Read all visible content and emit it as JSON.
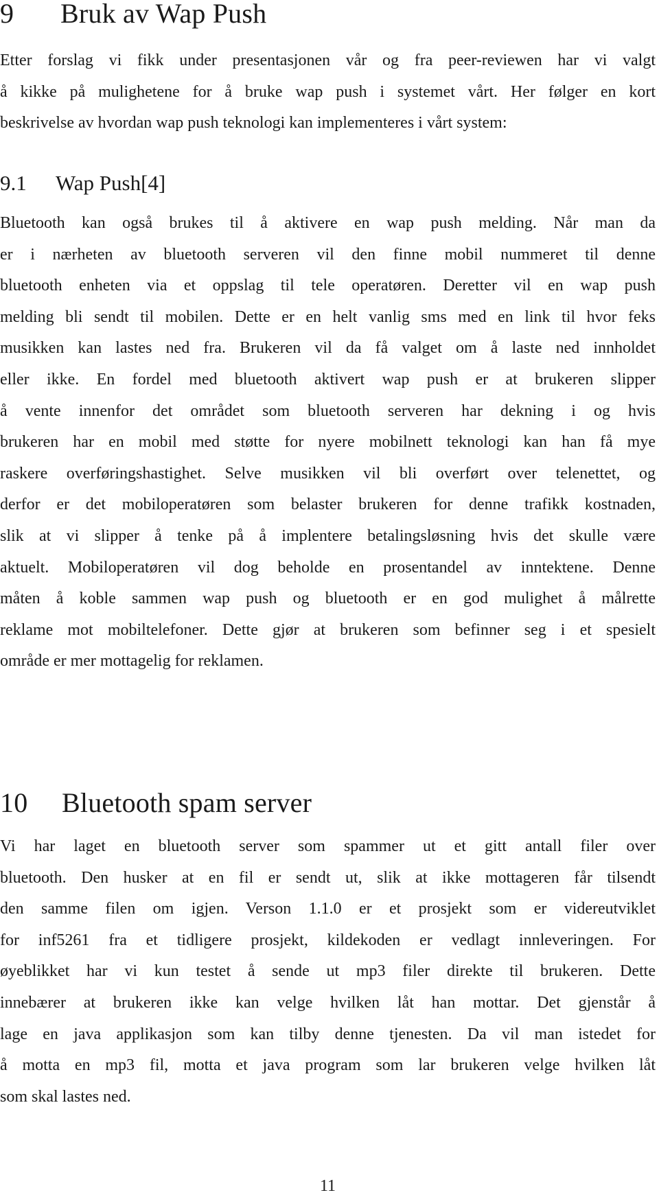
{
  "section_9": {
    "number": "9",
    "title": "Bruk av Wap Push",
    "intro_lines": [
      "Etter forslag vi fikk under presentasjonen vår og fra peer-reviewen har vi valgt",
      "å kikke på mulighetene for å bruke wap push i systemet vårt. Her følger en kort",
      "beskrivelse av hvordan wap push teknologi kan implementeres i vårt system:"
    ],
    "subsection_9_1": {
      "number": "9.1",
      "title": "Wap Push[4]",
      "lines": [
        "Bluetooth kan også brukes til å aktivere en wap push melding. Når man da",
        "er i nærheten av bluetooth serveren vil den finne mobil nummeret til denne",
        "bluetooth enheten via et oppslag til tele operatøren. Deretter vil en wap push",
        "melding bli sendt til mobilen. Dette er en helt vanlig sms med en link til hvor feks",
        "musikken kan lastes ned fra. Brukeren vil da få valget om å laste ned innholdet",
        "eller ikke. En fordel med bluetooth aktivert wap push er at brukeren slipper",
        "å vente innenfor det området som bluetooth serveren har dekning i og hvis",
        "brukeren har en mobil med støtte for nyere mobilnett teknologi kan han få mye",
        "raskere overføringshastighet. Selve musikken vil bli overført over telenettet, og",
        "derfor er det mobiloperatøren som belaster brukeren for denne trafikk kostnaden,",
        "slik at vi slipper å tenke på å implentere betalingsløsning hvis det skulle være",
        "aktuelt. Mobiloperatøren vil dog beholde en prosentandel av inntektene. Denne",
        "måten å koble sammen wap push og bluetooth er en god mulighet å målrette",
        "reklame mot mobiltelefoner. Dette gjør at brukeren som befinner seg i et spesielt",
        "område er mer mottagelig for reklamen."
      ]
    }
  },
  "section_10": {
    "number": "10",
    "title": "Bluetooth spam server",
    "lines": [
      "Vi har laget en bluetooth server som spammer ut et gitt antall filer over",
      "bluetooth. Den husker at en fil er sendt ut, slik at ikke mottageren får tilsendt",
      "den samme filen om igjen. Verson 1.1.0 er et prosjekt som er videreutviklet",
      "for inf5261 fra et tidligere prosjekt, kildekoden er vedlagt innleveringen. For",
      "øyeblikket har vi kun testet å sende ut mp3 filer direkte til brukeren. Dette",
      "innebærer at brukeren ikke kan velge hvilken låt han mottar. Det gjenstår å",
      "lage en java applikasjon som kan tilby denne tjenesten. Da vil man istedet for",
      "å motta en mp3 fil, motta et java program som lar brukeren velge hvilken låt",
      "som skal lastes ned."
    ]
  },
  "footer": {
    "page_number": "11"
  }
}
